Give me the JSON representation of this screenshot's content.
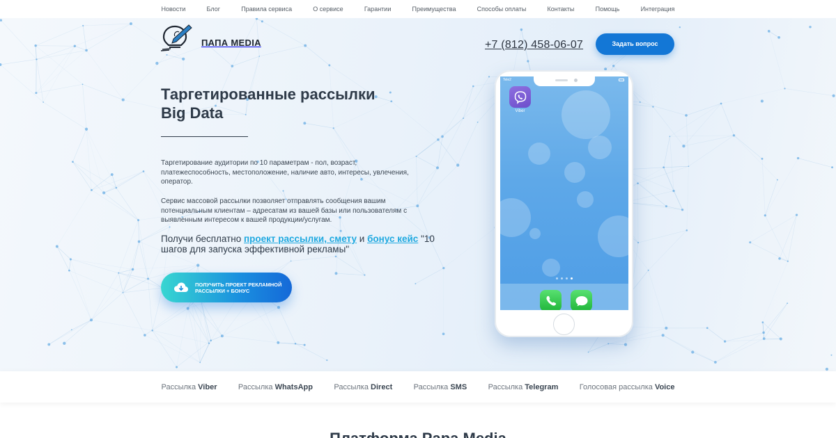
{
  "top_nav": {
    "items": [
      "Новости",
      "Блог",
      "Правила сервиса",
      "О сервисе",
      "Гарантии",
      "Преимущества",
      "Способы оплаты",
      "Контакты",
      "Помощь",
      "Интеграция"
    ]
  },
  "header": {
    "logo_text": "ПАПА MEDIA",
    "phone": "+7 (812) 458-06-07",
    "ask_button": "Задать вопрос"
  },
  "hero": {
    "title_line1": "Таргетированные рассылки",
    "title_line2": "Big Data",
    "description1": "Таргетирование аудитории по 10 параметрам - пол, возраст, платежеспособность, местоположение, наличие авто, интересы, увлечения, оператор.",
    "description2": "Сервис массовой рассылки позволяет отправлять сообщения вашим потенциальным клиентам – адресатам из вашей базы или пользователям с выявленным интересом к вашей продукции/услугам.",
    "offer": {
      "prefix": "Получи бесплатно ",
      "link1": "проект рассылки, смету",
      "middle": " и ",
      "link2": "бонус кейс",
      "suffix": " \"10 шагов для запуска эффективной рекламы\""
    },
    "cta_button": "Получить проект рекламной рассылки + бонус",
    "accent_color": "#1fa9e0",
    "cta_gradient": [
      "#38d6d1",
      "#1569d8"
    ]
  },
  "phone_mockup": {
    "carrier": "Tele2",
    "app_label": "Viber",
    "viber_color": "#7b5ad6",
    "dock_apps": [
      "phone-app",
      "messages-app"
    ]
  },
  "sub_nav": {
    "items": [
      {
        "prefix": "Рассылка ",
        "bold": "Viber"
      },
      {
        "prefix": "Рассылка ",
        "bold": "WhatsApp"
      },
      {
        "prefix": "Рассылка ",
        "bold": "Direct"
      },
      {
        "prefix": "Рассылка ",
        "bold": "SMS"
      },
      {
        "prefix": "Рассылка ",
        "bold": "Telegram"
      },
      {
        "prefix": "Голосовая рассылка ",
        "bold": "Voice"
      }
    ]
  },
  "next_section": {
    "heading": "Платформа Papa Media"
  }
}
